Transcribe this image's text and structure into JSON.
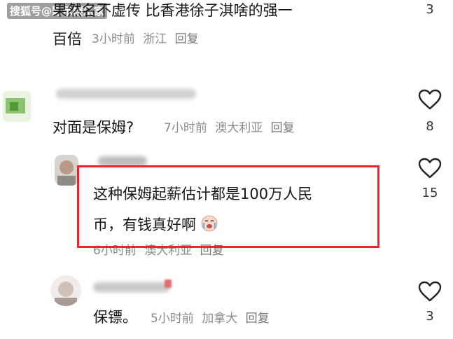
{
  "watermark": "搜狐号@影示娱乐家",
  "comments": [
    {
      "text_line1": "果然名不虚传 比香港徐子淇啥的强一",
      "text_line2": "百倍",
      "time": "3小时前",
      "location": "浙江",
      "reply": "回复",
      "likes": "3"
    },
    {
      "text": "对面是保姆?",
      "time": "7小时前",
      "location": "澳大利亚",
      "reply": "回复",
      "likes": "8"
    },
    {
      "text_line1": "这种保姆起薪估计都是100万人民",
      "text_line2": "币，有钱真好啊",
      "time": "6小时前",
      "location": "澳大利亚",
      "reply": "回复",
      "likes": "15",
      "highlighted": true
    },
    {
      "text": "保镖。",
      "time": "5小时前",
      "location": "加拿大",
      "reply": "回复",
      "likes": "3"
    }
  ],
  "colors": {
    "highlight": "#e8262b",
    "meta": "#8a8a8a",
    "text": "#161616"
  },
  "icons": [
    "heart-outline-icon",
    "crying-emoji-icon"
  ]
}
